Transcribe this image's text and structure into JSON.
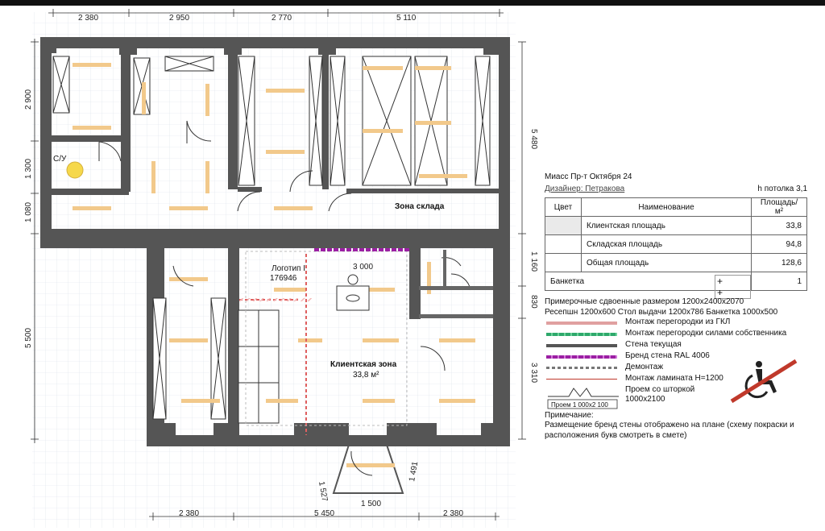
{
  "dimensions": {
    "top": [
      "2 380",
      "2 950",
      "2 770",
      "5 110"
    ],
    "bottom": [
      "2 380",
      "5 450",
      "2 380"
    ],
    "left": [
      "2 900",
      "1 300",
      "1 080",
      "5 500"
    ],
    "right": [
      "5 480",
      "1 160",
      "830",
      "3 310"
    ],
    "inner_width": "3 000",
    "entrance_left": "1 527",
    "entrance_right": "1 491",
    "entrance_front": "1 500"
  },
  "rooms": {
    "wc": "С/У",
    "warehouse": "Зона склада",
    "client_zone": "Клиентская зона",
    "client_area": "33,8 м²"
  },
  "logo": {
    "label": "Логотип I",
    "number": "176946"
  },
  "panel": {
    "address": "Миасс Пр-т Октября 24",
    "designer": "Дизайнер: Петракова",
    "ceiling": "h потолка 3,1",
    "table_header": {
      "color": "Цвет",
      "name": "Наименование",
      "area": "Площадь/м²"
    },
    "rows": [
      {
        "name": "Клиентская площадь",
        "value": "33,8"
      },
      {
        "name": "Складская площадь",
        "value": "94,8"
      },
      {
        "name": "Общая площадь",
        "value": "128,6"
      }
    ],
    "bench": {
      "name": "Банкетка",
      "symbol": "+ +",
      "value": "1"
    },
    "notes": [
      "Примерочные сдвоенные размером 1200х2400х2070",
      "Ресепшн 1200х600   Стол выдачи 1200х786   Банкетка 1000х500"
    ],
    "legend": [
      {
        "text": "Монтаж перегородки из ГКЛ",
        "color": "#e0a0a0",
        "style": "solid"
      },
      {
        "text": "Монтаж перегородки силами собственника",
        "color": "#2ea86b",
        "style": "dashed"
      },
      {
        "text": "Стена текущая",
        "color": "#555555",
        "style": "solid"
      },
      {
        "text": "Бренд стена RAL 4006",
        "color": "#9b1fa3",
        "style": "dashed"
      },
      {
        "text": "Демонтаж",
        "color": "#777777",
        "style": "dashed"
      },
      {
        "text": "Монтаж ламината H=1200",
        "color": "#c0392b",
        "style": "thin"
      },
      {
        "text": "Проем со шторкой 1000х2100",
        "color": "#333333",
        "style": "opening"
      }
    ],
    "opening_label": "Проем 1 000х2 100",
    "remark_title": "Примечание:",
    "remark": "Размещение бренд стены отображено на плане (схему покраски и расположения букв смотреть в смете)"
  },
  "colors": {
    "wall": "#555555",
    "fixture": "#f2c98b",
    "grid": "#cfd6e4",
    "brand": "#9b1fa3",
    "accessibility": "#c0392b"
  }
}
